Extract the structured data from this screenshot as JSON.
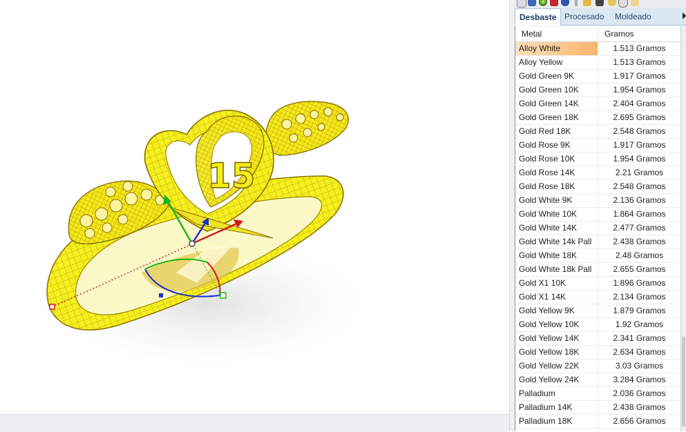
{
  "panel": {
    "tabs": [
      {
        "label": "Desbaste",
        "active": true
      },
      {
        "label": "Procesado",
        "active": false
      },
      {
        "label": "Moldeado",
        "active": false
      }
    ],
    "toolbar_icons": [
      "home-icon",
      "image-icon",
      "color-sphere-icon",
      "shield-icon",
      "globe-icon",
      "pen-icon",
      "folder-icon",
      "camera-icon",
      "star-icon",
      "clock-icon",
      "document-icon"
    ],
    "table": {
      "columns": [
        "Metal",
        "Gramos"
      ],
      "selected_row": 0,
      "rows": [
        {
          "metal": "Alloy White",
          "gramos": "1.513 Gramos"
        },
        {
          "metal": "Alloy Yellow",
          "gramos": "1.513 Gramos"
        },
        {
          "metal": "Gold Green 9K",
          "gramos": "1.917 Gramos"
        },
        {
          "metal": "Gold Green 10K",
          "gramos": "1.954 Gramos"
        },
        {
          "metal": "Gold Green 14K",
          "gramos": "2.404 Gramos"
        },
        {
          "metal": "Gold Green 18K",
          "gramos": "2.695 Gramos"
        },
        {
          "metal": "Gold Red 18K",
          "gramos": "2.548 Gramos"
        },
        {
          "metal": "Gold Rose 9K",
          "gramos": "1.917 Gramos"
        },
        {
          "metal": "Gold Rose 10K",
          "gramos": "1.954 Gramos"
        },
        {
          "metal": "Gold Rose 14K",
          "gramos": "2.21 Gramos"
        },
        {
          "metal": "Gold Rose 18K",
          "gramos": "2.548 Gramos"
        },
        {
          "metal": "Gold White 9K",
          "gramos": "2.136 Gramos"
        },
        {
          "metal": "Gold White 10K",
          "gramos": "1.864 Gramos"
        },
        {
          "metal": "Gold White 14K",
          "gramos": "2.477 Gramos"
        },
        {
          "metal": "Gold White 14k Pall",
          "gramos": "2.438 Gramos"
        },
        {
          "metal": "Gold White 18K",
          "gramos": "2.48 Gramos"
        },
        {
          "metal": "Gold White 18k Pall",
          "gramos": "2.655 Gramos"
        },
        {
          "metal": "Gold X1 10K",
          "gramos": "1.896 Gramos"
        },
        {
          "metal": "Gold X1 14K",
          "gramos": "2.134 Gramos"
        },
        {
          "metal": "Gold Yellow 9K",
          "gramos": "1.879 Gramos"
        },
        {
          "metal": "Gold Yellow 10K",
          "gramos": "1.92 Gramos"
        },
        {
          "metal": "Gold Yellow 14K",
          "gramos": "2.341 Gramos"
        },
        {
          "metal": "Gold Yellow 18K",
          "gramos": "2.634 Gramos"
        },
        {
          "metal": "Gold Yellow 22K",
          "gramos": "3.03 Gramos"
        },
        {
          "metal": "Gold Yellow 24K",
          "gramos": "3.284 Gramos"
        },
        {
          "metal": "Palladium",
          "gramos": "2.036 Gramos"
        },
        {
          "metal": "Palladium 14K",
          "gramos": "2.438 Gramos"
        },
        {
          "metal": "Palladium 18K",
          "gramos": "2.656 Gramos"
        }
      ]
    }
  },
  "viewport": {
    "model_color": "#f4ee1c",
    "wire_color": "#c9a800",
    "gumball_colors": {
      "x": "#d21b1b",
      "y": "#17b81a",
      "z": "#1a2fd0"
    },
    "heart_number": "15"
  }
}
